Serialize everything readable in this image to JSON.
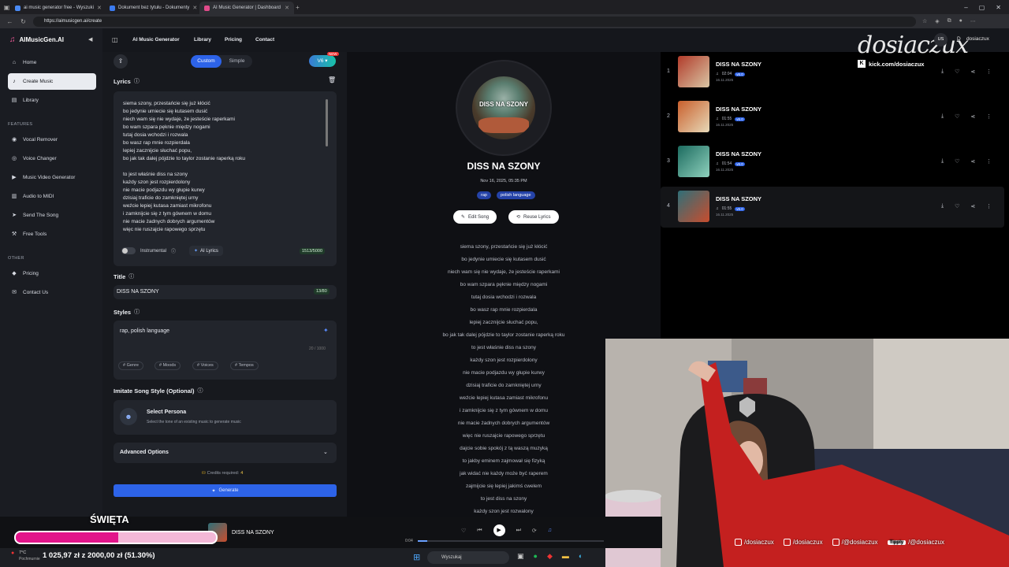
{
  "browser": {
    "tabs": [
      {
        "title": "ai music generator free - Wyszuki",
        "color": "#4a8af4"
      },
      {
        "title": "Dokument bez tytułu - Dokumenty",
        "color": "#3b7bf0"
      },
      {
        "title": "AI Music Generator | Dashboard",
        "color": "#e04a8a"
      }
    ],
    "url": "https://aimusicgen.ai/create"
  },
  "sidebar": {
    "brand": "AIMusicGen.AI",
    "main": [
      {
        "label": "Home",
        "icon": "home-icon"
      },
      {
        "label": "Create Music",
        "icon": "music-note-icon"
      },
      {
        "label": "Library",
        "icon": "library-icon"
      }
    ],
    "features_label": "FEATURES",
    "features": [
      {
        "label": "Vocal Remover",
        "icon": "vocal-remover-icon"
      },
      {
        "label": "Voice Changer",
        "icon": "voice-changer-icon"
      },
      {
        "label": "Music Video Generator",
        "icon": "video-icon"
      },
      {
        "label": "Audio to MIDI",
        "icon": "midi-icon"
      },
      {
        "label": "Send The Song",
        "icon": "send-icon"
      },
      {
        "label": "Free Tools",
        "icon": "tools-icon"
      }
    ],
    "other_label": "OTHER",
    "other": [
      {
        "label": "Pricing",
        "icon": "tag-icon"
      },
      {
        "label": "Contact Us",
        "icon": "mail-icon"
      }
    ]
  },
  "topnav": {
    "items": [
      "AI Music Generator",
      "Library",
      "Pricing",
      "Contact"
    ],
    "avatar_initials": "US",
    "account_initial": "D",
    "account_name": "dosiaczux"
  },
  "form": {
    "modes": [
      "Custom",
      "Simple"
    ],
    "version": "V6",
    "version_badge": "NEW",
    "lyrics_label": "Lyrics",
    "lyrics_text": "siema szony, przestańcie się już kłócić\nbo jedynie umiecie się kutasem dusić\nniech wam się nie wydaje, że jesteście raperkami\nbo wam szpara pęknie między nogami\ntutaj dosia wchodzi i rozwala\nbo wasz rap mnie rozpierdala\nlepiej zacznijcie słuchać popu,\nbo jak tak dalej pójdzie to taylor zostanie raperką roku\n\nto jest właśnie diss na szony\nkażdy szon jest rozpierdolony\nnie macie podjazdu wy głupie kurwy\ndzisiaj traficie do zamkniętej urny\nweźcie lepiej kutasa zamiast mikrofonu\ni zamknijcie się z tym gównem w domu\nnie macie żadnych dobrych argumentów\nwięc nie ruszajcie rapowego sprzętu",
    "instrumental_label": "Instrumental",
    "ai_lyrics_label": "AI Lyrics",
    "lyrics_count": "1513/5000",
    "title_label": "Title",
    "title_value": "DISS NA SZONY",
    "title_count": "13/80",
    "styles_label": "Styles",
    "styles_value": "rap, polish language",
    "styles_count": "20 / 1000",
    "style_chips": [
      "# Genre",
      "# Moods",
      "# Voices",
      "# Tempos"
    ],
    "imitate_label": "Imitate Song Style (Optional)",
    "persona_title": "Select Persona",
    "persona_desc": "Select the tone of an existing music to generate music",
    "advanced_label": "Advanced Options",
    "credits_text": "Credits required: ",
    "credits_value": "4",
    "generate_label": "Generate"
  },
  "song": {
    "art_text": "DISS NA SZONY",
    "title": "DISS NA SZONY",
    "date": "Nov 16, 2025, 05:35 PM",
    "tags": [
      "rap",
      "polish language"
    ],
    "edit_label": "Edit Song",
    "reuse_label": "Reuse Lyrics",
    "lines": [
      "siema szony, przestańcie się już kłócić",
      "bo jedynie umiecie się kutasem dusić",
      "niech wam się nie wydaje, że jesteście raperkami",
      "bo wam szpara pęknie między nogami",
      "tutaj dosia wchodzi i rozwala",
      "bo wasz rap mnie rozpierdala",
      "lepiej zacznijcie słuchać popu,",
      "bo jak tak dalej pójdzie to taylor zostanie raperką roku",
      "to jest właśnie diss na szony",
      "każdy szon jest rozpierdolony",
      "nie macie podjazdu wy głupie kurwy",
      "dzisiaj traficie do zamkniętej urny",
      "weźcie lepiej kutasa zamiast mikrofonu",
      "i zamknijcie się z tym gównem w domu",
      "nie macie żadnych dobrych argumentów",
      "więc nie ruszajcie rapowego sprzętu",
      "dajcie sobie spokój z tą waszą muzyką",
      "to jakby eminem zajmował się fizyką",
      "jak widać nie każdy może być raperem",
      "zajmijcie się lepiej jakimś cwelem",
      "to jest diss na szony",
      "każdy szon jest rozwalony"
    ]
  },
  "list": [
    {
      "num": "1",
      "title": "DISS NA SZONY",
      "duration": "02:04",
      "version": "v6.0",
      "date": "16.11.2025",
      "colors": [
        "#b13b2a",
        "#d9c6a5"
      ]
    },
    {
      "num": "2",
      "title": "DISS NA SZONY",
      "duration": "01:55",
      "version": "v6.0",
      "date": "16.11.2025",
      "colors": [
        "#c95f2c",
        "#e7d9b8"
      ]
    },
    {
      "num": "3",
      "title": "DISS NA SZONY",
      "duration": "01:54",
      "version": "v6.0",
      "date": "16.11.2025",
      "colors": [
        "#1c6b5f",
        "#8fd1bd"
      ]
    },
    {
      "num": "4",
      "title": "DISS NA SZONY",
      "duration": "01:55",
      "version": "v6.0",
      "date": "16.11.2025",
      "colors": [
        "#2f6f78",
        "#c84d2e"
      ]
    }
  ],
  "watermark": {
    "name": "dosiaczux",
    "kick": "kick.com/dosiaczux"
  },
  "player": {
    "title": "DISS NA SZONY",
    "time": "0:04",
    "progress": 0.05
  },
  "overlay": {
    "goal_title": "ŚWIĘTA",
    "goal_text": "1 025,97 zł z 2000,00 zł (51.30%)",
    "goal_fraction": 0.513,
    "socials": [
      "/dosiaczux",
      "/dosiaczux",
      "/@dosiaczux",
      "/@dosiaczux"
    ],
    "social_icons": [
      "instagram-icon",
      "tiktok-icon",
      "youtube-icon",
      "tipply-icon"
    ],
    "tipply_label": "Tipply"
  },
  "taskbar": {
    "search": "Wyszukaj",
    "weather": "7°C",
    "weather_desc": "Pochmurnie"
  }
}
